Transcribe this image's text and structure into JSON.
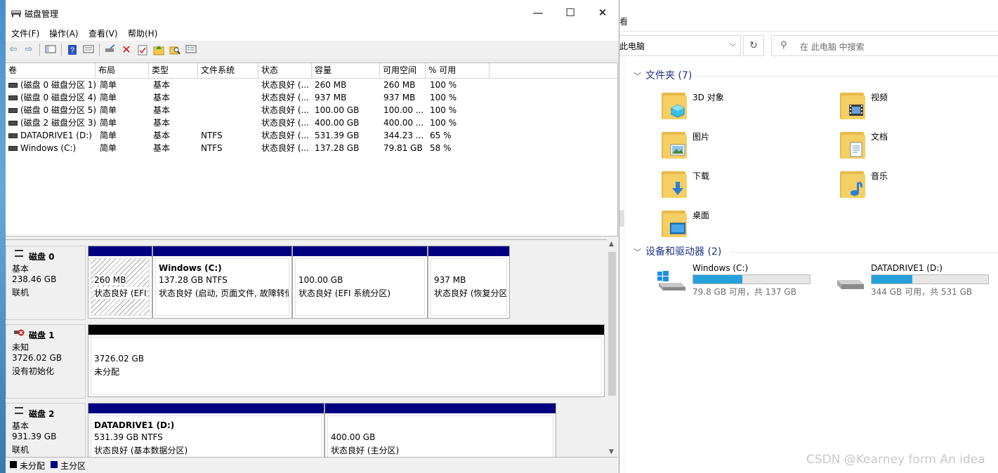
{
  "window": {
    "title": "磁盘管理",
    "menus": [
      "文件(F)",
      "操作(A)",
      "查看(V)",
      "帮助(H)"
    ]
  },
  "volume_table": {
    "headers": [
      "卷",
      "布局",
      "类型",
      "文件系统",
      "状态",
      "容量",
      "可用空间",
      "% 可用"
    ],
    "rows": [
      [
        "(磁盘 0 磁盘分区 1)",
        "简单",
        "基本",
        "",
        "状态良好 (...",
        "260 MB",
        "260 MB",
        "100 %"
      ],
      [
        "(磁盘 0 磁盘分区 4)",
        "简单",
        "基本",
        "",
        "状态良好 (...",
        "937 MB",
        "937 MB",
        "100 %"
      ],
      [
        "(磁盘 0 磁盘分区 5)",
        "简单",
        "基本",
        "",
        "状态良好 (...",
        "100.00 GB",
        "100.00 ...",
        "100 %"
      ],
      [
        "(磁盘 2 磁盘分区 3)",
        "简单",
        "基本",
        "",
        "状态良好 (...",
        "400.00 GB",
        "400.00 ...",
        "100 %"
      ],
      [
        "DATADRIVE1 (D:)",
        "简单",
        "基本",
        "NTFS",
        "状态良好 (...",
        "531.39 GB",
        "344.23 ...",
        "65 %"
      ],
      [
        "Windows  (C:)",
        "简单",
        "基本",
        "NTFS",
        "状态良好 (...",
        "137.28 GB",
        "79.81 GB",
        "58 %"
      ]
    ]
  },
  "disks": [
    {
      "name": "磁盘 0",
      "type": "基本",
      "size": "238.46 GB",
      "status": "联机",
      "partitions": [
        {
          "title": "",
          "line1": "260 MB",
          "line2": "状态良好 (EFI"
        },
        {
          "title": "Windows   (C:)",
          "line1": "137.28 GB NTFS",
          "line2": "状态良好 (启动, 页面文件, 故障转储"
        },
        {
          "title": "",
          "line1": "100.00 GB",
          "line2": "状态良好 (EFI 系统分区)"
        },
        {
          "title": "",
          "line1": "937 MB",
          "line2": "状态良好 (恢复分区"
        }
      ]
    },
    {
      "name": "磁盘 1",
      "type": "未知",
      "size": "3726.02 GB",
      "status": "没有初始化",
      "partitions": [
        {
          "title": "",
          "line1": "3726.02 GB",
          "line2": "未分配"
        }
      ]
    },
    {
      "name": "磁盘 2",
      "type": "基本",
      "size": "931.39 GB",
      "status": "联机",
      "partitions": [
        {
          "title": "DATADRIVE1  (D:)",
          "line1": "531.39 GB NTFS",
          "line2": "状态良好 (基本数据分区)"
        },
        {
          "title": "",
          "line1": "400.00 GB",
          "line2": "状态良好 (主分区)"
        }
      ]
    }
  ],
  "legend": {
    "unallocated": "未分配",
    "primary": "主分区",
    "unallocated_color": "#000000",
    "primary_color": "#000080"
  },
  "explorer": {
    "view_menu": "看",
    "address": "此电脑",
    "search_placeholder": "在 此电脑 中搜索",
    "folders_header": "文件夹 (7)",
    "folders": [
      "3D 对象",
      "视频",
      "图片",
      "文档",
      "下载",
      "音乐",
      "桌面"
    ],
    "devices_header": "设备和驱动器 (2)",
    "drives": [
      {
        "name": "Windows  (C:)",
        "info": "79.8 GB 可用，共 137 GB",
        "used_fraction": 0.42
      },
      {
        "name": "DATADRIVE1 (D:)",
        "info": "344 GB 可用，共 531 GB",
        "used_fraction": 0.35
      }
    ],
    "accent": "#26a0da"
  },
  "watermark": "CSDN @Kearney form An idea"
}
